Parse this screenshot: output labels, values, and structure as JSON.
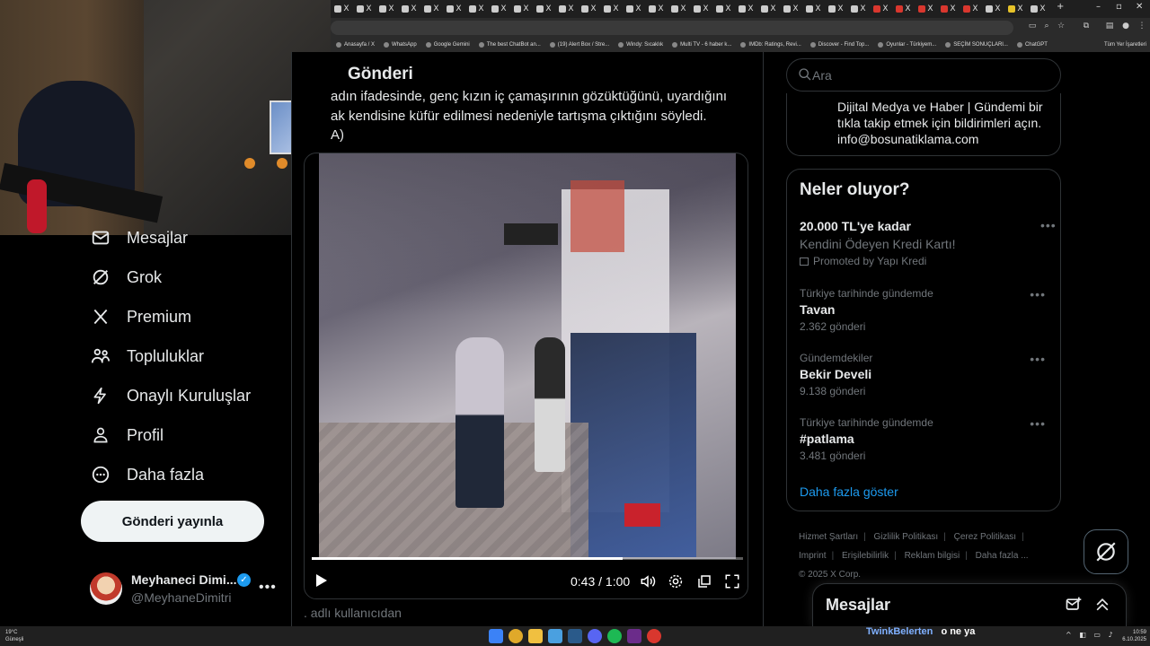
{
  "browser": {
    "tabs": [
      "X",
      "X",
      "X",
      "X",
      "X",
      "X",
      "X",
      "X",
      "X",
      "X",
      "X",
      "X",
      "X",
      "X",
      "X",
      "X",
      "X",
      "X",
      "X",
      "X",
      "X",
      "X",
      "X",
      "X",
      "X",
      "X",
      "X",
      "X",
      "X",
      "X",
      "X",
      "X"
    ],
    "bookmarks": [
      "Anasayfa / X",
      "WhatsApp",
      "Google Gemini",
      "The best ChatBot an...",
      "(19) Alert Box / Stre...",
      "Windy: Sıcaklık",
      "Multi TV - 6 haber k...",
      "IMDb: Ratings, Revi...",
      "Discover - Find Top...",
      "Oyunlar - Türkiyem...",
      "SEÇİM SONUÇLARI...",
      "ChatGPT"
    ],
    "all_bookmarks": "Tüm Yer İşaretleri"
  },
  "nav": {
    "items": [
      {
        "label": "Mesajlar",
        "icon": "mail-icon"
      },
      {
        "label": "Grok",
        "icon": "grok-icon"
      },
      {
        "label": "Premium",
        "icon": "x-logo-icon"
      },
      {
        "label": "Topluluklar",
        "icon": "communities-icon"
      },
      {
        "label": "Onaylı Kuruluşlar",
        "icon": "lightning-icon"
      },
      {
        "label": "Profil",
        "icon": "person-icon"
      },
      {
        "label": "Daha fazla",
        "icon": "more-circle-icon"
      }
    ],
    "post_button": "Gönderi yayınla"
  },
  "account": {
    "name": "Meyhaneci Dimi...",
    "handle": "@MeyhaneDimitri"
  },
  "main": {
    "title": "Gönderi",
    "text_lines": [
      "adın ifadesinde, genç kızın iç çamaşırının gözüktüğünü, uyardığını",
      "ak kendisine küfür edilmesi nedeniyle tartışma çıktığını söyledi.",
      "A)"
    ],
    "video": {
      "time": "0:43 / 1:00",
      "progress": 0.72
    },
    "below_text": ". adlı kullanıcıdan"
  },
  "sidebar": {
    "search_placeholder": "Ara",
    "profile_lines": [
      "Dijital Medya ve Haber | Gündemi bir",
      "tıkla takip etmek için bildirimleri açın.",
      "info@bosunatiklama.com"
    ],
    "trends_title": "Neler oluyor?",
    "ad": {
      "title": "20.000 TL'ye kadar",
      "description": "Kendini Ödeyen Kredi Kartı!",
      "promoted": "Promoted by Yapı Kredi"
    },
    "trends": [
      {
        "context": "Türkiye tarihinde gündemde",
        "name": "Tavan",
        "count": "2.362 gönderi"
      },
      {
        "context": "Gündemdekiler",
        "name": "Bekir Develi",
        "count": "9.138 gönderi"
      },
      {
        "context": "Türkiye tarihinde gündemde",
        "name": "#patlama",
        "count": "3.481 gönderi"
      }
    ],
    "show_more": "Daha fazla göster",
    "footer": [
      "Hizmet Şartları",
      "Gizlilik Politikası",
      "Çerez Politikası",
      "Imprint",
      "Erişilebilirlik",
      "Reklam bilgisi",
      "Daha fazla ...",
      "© 2025 X Corp."
    ]
  },
  "messages_drawer": {
    "title": "Mesajlar"
  },
  "chat_overlay": {
    "user": "TwinkBelerten",
    "message": "o ne ya"
  },
  "taskbar": {
    "weather_temp": "19°C",
    "weather_desc": "Güneşli",
    "time": "10:59",
    "date": "6.10.2025"
  },
  "colors": {
    "accent": "#1d9bf0",
    "background": "#000000",
    "border": "#2f3336",
    "muted_text": "#71767b"
  }
}
